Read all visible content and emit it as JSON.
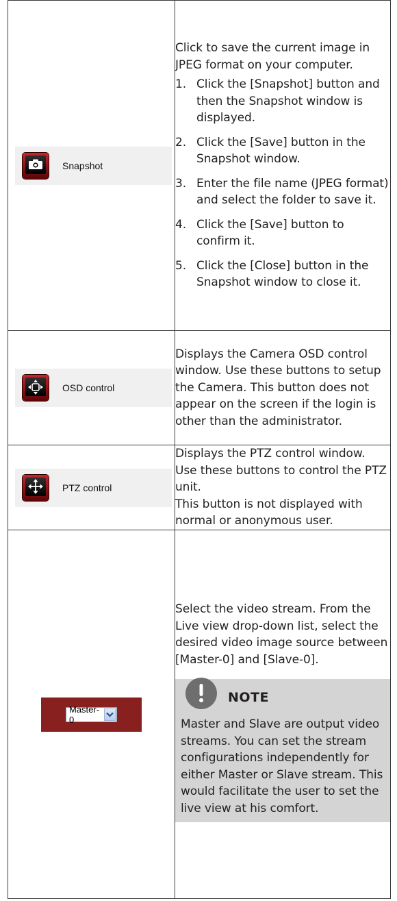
{
  "rows": [
    {
      "button_label": "Snapshot",
      "icon": "camera-icon",
      "intro": "Click to save the current image in JPEG format on your computer.",
      "steps": [
        {
          "num": "1.",
          "text": "Click the [Snapshot] button and then the Snapshot window is displayed."
        },
        {
          "num": "2.",
          "text": "Click the [Save] button in the Snapshot window."
        },
        {
          "num": "3.",
          "text": "Enter the file name (JPEG format) and select the folder to save it."
        },
        {
          "num": "4.",
          "text": "Click the [Save] button to confirm it."
        },
        {
          "num": "5.",
          "text": "Click the [Close] button in the Snapshot window to close it."
        }
      ]
    },
    {
      "button_label": "OSD control",
      "icon": "osd-directional-icon",
      "desc": "Displays the Camera OSD control window. Use these buttons to setup the Camera. This button does not appear on the screen if the login is other than the administrator."
    },
    {
      "button_label": "PTZ control",
      "icon": "ptz-arrows-icon",
      "desc_line1": "Displays the PTZ control window. Use these buttons to control the PTZ unit.",
      "desc_line2": "This button is not displayed with normal or anonymous user."
    },
    {
      "select_value": "Master-0",
      "icon": "chevron-down-icon",
      "desc": "Select the video stream. From the Live view drop-down list, select the desired video image source between [Master-0] and [Slave-0].",
      "note_title": "NOTE",
      "note_icon": "exclamation-icon",
      "note_text": "Master and Slave are output video streams. You can set the stream configurations independently for either Master or Slave stream. This would facilitate the user to set the live view at his comfort."
    }
  ]
}
